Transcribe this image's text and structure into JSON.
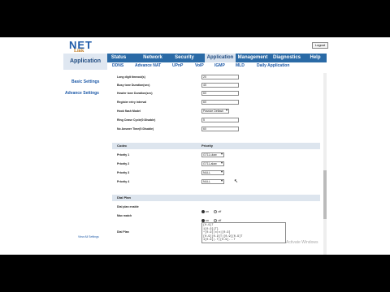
{
  "header": {
    "logo_text": "NET",
    "logo_sub": "Link",
    "logout_label": "Logout"
  },
  "nav": {
    "section_title": "Application",
    "tabs": [
      {
        "label": "Status"
      },
      {
        "label": "Network"
      },
      {
        "label": "Security"
      },
      {
        "label": "Application"
      },
      {
        "label": "Management"
      },
      {
        "label": "Diagnostics"
      },
      {
        "label": "Help"
      }
    ],
    "active_tab": "Application"
  },
  "subnav": {
    "items": [
      {
        "label": "DDNS"
      },
      {
        "label": "Advance NAT"
      },
      {
        "label": "UPnP"
      },
      {
        "label": "VoIP"
      },
      {
        "label": "IGMP"
      },
      {
        "label": "MLD"
      },
      {
        "label": "Daily Application"
      }
    ],
    "active_item": "VoIP"
  },
  "sidebar": {
    "items": [
      {
        "label": "Basic Settings"
      },
      {
        "label": "Advance Settings"
      }
    ],
    "footer_link": "View All Settings"
  },
  "settings": {
    "rows": [
      {
        "label": "Long digit timeout(s)",
        "value": "20"
      },
      {
        "label": "Busy tone Duration(sec)",
        "value": "40"
      },
      {
        "label": "Howler tone Duration(sec)",
        "value": "60"
      },
      {
        "label": "Register retry interval",
        "value": "60"
      }
    ],
    "hook_label": "Hook flash Model",
    "hook_value": "Passive Deflash",
    "ring_off_label": "Ring Cease Cycle(0:Disable)",
    "ring_off_value": "5",
    "no_answer_label": "No Answer Time(0:Disable)",
    "no_answer_value": "60"
  },
  "codec": {
    "col_codec": "Codec",
    "col_priority": "Priority",
    "rows": [
      {
        "label": "Priority 1",
        "value": "G711-ulaw"
      },
      {
        "label": "Priority 2",
        "value": "G711-alaw"
      },
      {
        "label": "Priority 3",
        "value": "NULL"
      },
      {
        "label": "Priority 4",
        "value": "NULL"
      }
    ]
  },
  "dial_plan": {
    "title": "Dial Plan",
    "dial_plan_enable_label": "Dial plan enable",
    "max_match_label": "Max match",
    "on_label": "on",
    "off_label": "off",
    "dial_plan_label": "Dial Plan",
    "dial_plan_value": "[0-9]T\n1[0-9]{T}\n*[0-9]|x|x|[0-9]\n[0-9][0-9]T|[0-9][0-9]T\n1[0-9]|.T|[0-9]...T"
  },
  "watermark_text": "Activate Windows"
}
